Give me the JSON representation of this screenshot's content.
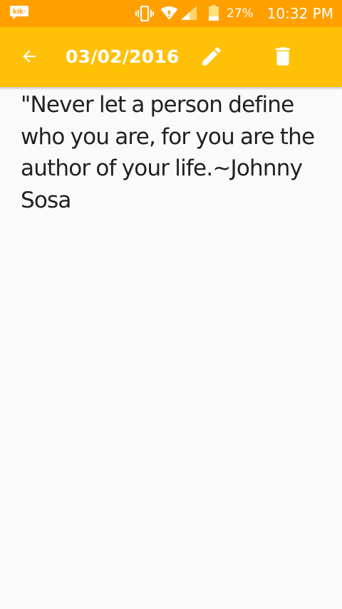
{
  "status_bar": {
    "notification_icon": "kik-logo",
    "battery_percent": "27%",
    "time": "10:32 PM",
    "icons": [
      "vibrate-icon",
      "wifi-icon",
      "signal-icon",
      "battery-icon"
    ]
  },
  "toolbar": {
    "title": "03/02/2016",
    "icons": [
      "back-arrow-icon",
      "pencil-icon",
      "trash-icon"
    ]
  },
  "note": {
    "lines": [
      "\"Never let a person define",
      "who you are, for you are the",
      "author of your life.~Johnny",
      "Sosa"
    ]
  },
  "colors": {
    "status_bar": "#ffa000",
    "app_bar": "#ffc107",
    "background": "#fafafa",
    "text": "#212121"
  }
}
